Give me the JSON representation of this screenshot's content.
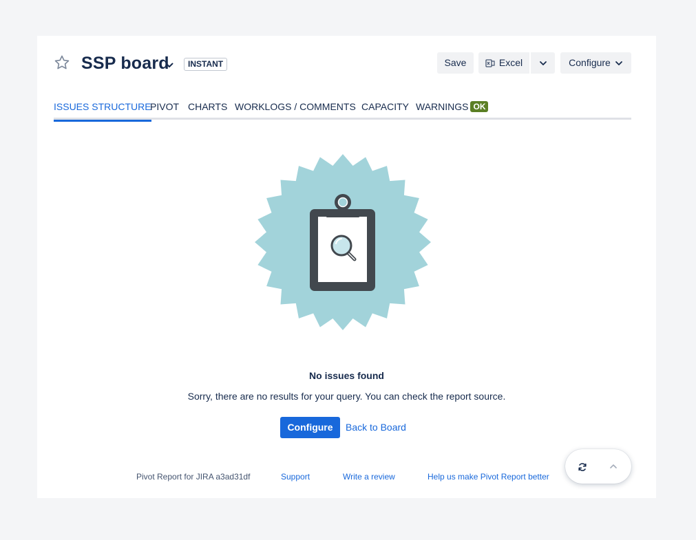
{
  "header": {
    "title": "SSP board",
    "badge": "INSTANT",
    "buttons": {
      "save": "Save",
      "excel": "Excel",
      "configure": "Configure"
    }
  },
  "tabs": [
    {
      "label": "ISSUES STRUCTURE",
      "active": true
    },
    {
      "label": "PIVOT"
    },
    {
      "label": "CHARTS"
    },
    {
      "label": "WORKLOGS / COMMENTS"
    },
    {
      "label": "CAPACITY"
    },
    {
      "label": "WARNINGS",
      "badge": "OK"
    }
  ],
  "empty_state": {
    "title": "No issues found",
    "description": "Sorry, there are no results for your query. You can check the report source.",
    "primary_button": "Configure",
    "secondary_link": "Back to Board"
  },
  "footer": {
    "version": "Pivot Report for JIRA a3ad31df",
    "links": [
      "Support",
      "Write a review",
      "Help us make Pivot Report better"
    ]
  },
  "colors": {
    "accent": "#1868db",
    "ok_badge": "#5b7f24",
    "illustration_bg": "#a2d3da",
    "clipboard": "#42484e"
  },
  "icons": {
    "favorite": "star-icon",
    "title_dropdown": "chevron-down-icon",
    "excel": "excel-icon",
    "refresh": "refresh-icon",
    "scroll_top": "chevron-up-icon"
  }
}
